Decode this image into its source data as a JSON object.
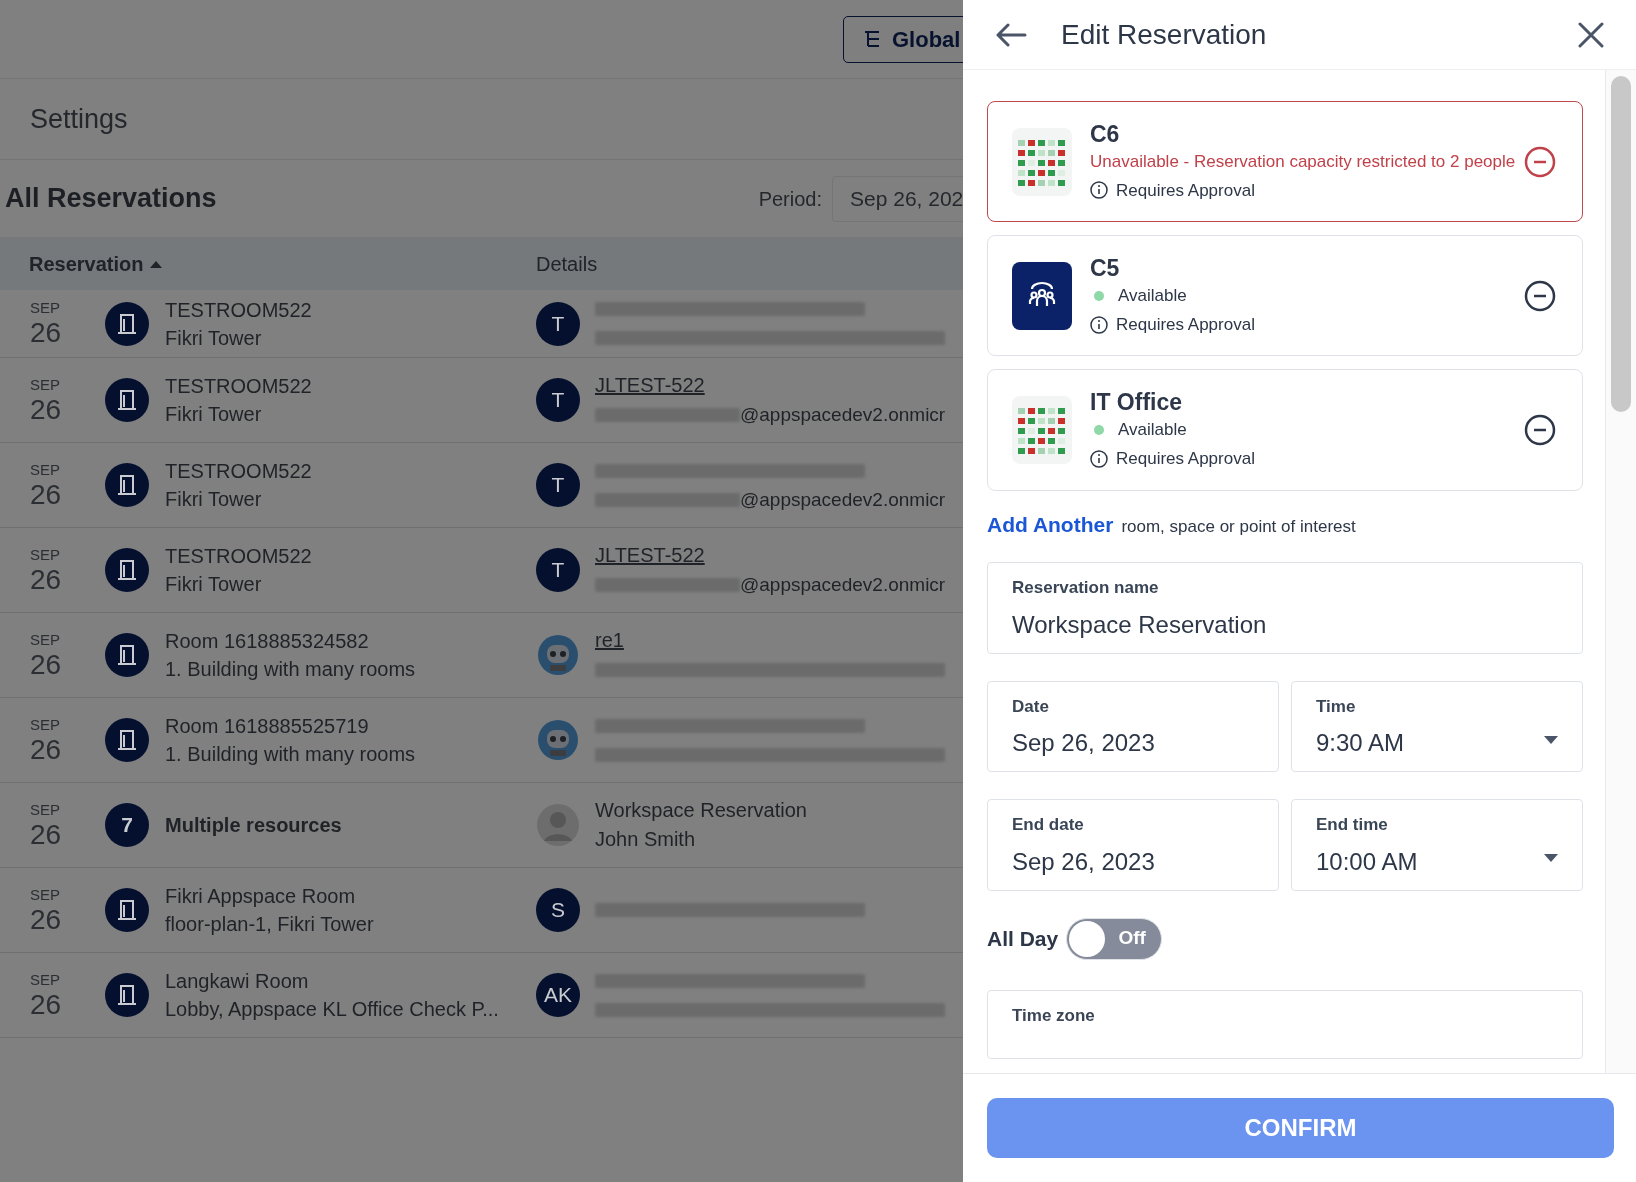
{
  "header": {
    "global_button": "Global"
  },
  "page_title": "Settings",
  "section": {
    "title": "All Reservations",
    "period_label": "Period:",
    "period_value": "Sep 26, 202"
  },
  "table": {
    "columns": [
      {
        "label": "Reservation",
        "sorted": true
      },
      {
        "label": "Details",
        "sorted": false
      }
    ],
    "rows": [
      {
        "month": "SEP",
        "day": "26",
        "resource": {
          "kind": "door"
        },
        "title": "TESTROOM522",
        "subtitle": "Fikri Tower",
        "avatar": {
          "kind": "initial",
          "text": "T"
        },
        "details": [
          {
            "kind": "redacted"
          },
          {
            "kind": "redacted"
          }
        ]
      },
      {
        "month": "SEP",
        "day": "26",
        "resource": {
          "kind": "door"
        },
        "title": "TESTROOM522",
        "subtitle": "Fikri Tower",
        "avatar": {
          "kind": "initial",
          "text": "T"
        },
        "details": [
          {
            "kind": "link",
            "text": "JLTEST-522"
          },
          {
            "kind": "masked",
            "text": "@appspacedev2.onmicr"
          }
        ]
      },
      {
        "month": "SEP",
        "day": "26",
        "resource": {
          "kind": "door"
        },
        "title": "TESTROOM522",
        "subtitle": "Fikri Tower",
        "avatar": {
          "kind": "initial",
          "text": "T"
        },
        "details": [
          {
            "kind": "redacted"
          },
          {
            "kind": "masked",
            "text": "@appspacedev2.onmicr"
          }
        ]
      },
      {
        "month": "SEP",
        "day": "26",
        "resource": {
          "kind": "door"
        },
        "title": "TESTROOM522",
        "subtitle": "Fikri Tower",
        "avatar": {
          "kind": "initial",
          "text": "T"
        },
        "details": [
          {
            "kind": "link",
            "text": "JLTEST-522"
          },
          {
            "kind": "masked",
            "text": "@appspacedev2.onmicr"
          }
        ]
      },
      {
        "month": "SEP",
        "day": "26",
        "resource": {
          "kind": "door"
        },
        "title": "Room 1618885324582",
        "subtitle": "1. Building with many rooms",
        "avatar": {
          "kind": "robot"
        },
        "details": [
          {
            "kind": "link",
            "text": "re1"
          },
          {
            "kind": "redacted"
          }
        ]
      },
      {
        "month": "SEP",
        "day": "26",
        "resource": {
          "kind": "door"
        },
        "title": "Room 1618885525719",
        "subtitle": "1. Building with many rooms",
        "avatar": {
          "kind": "robot"
        },
        "details": [
          {
            "kind": "redacted"
          },
          {
            "kind": "redacted"
          }
        ]
      },
      {
        "month": "SEP",
        "day": "26",
        "resource": {
          "kind": "count",
          "text": "7"
        },
        "title": "Multiple resources",
        "avatar": {
          "kind": "photo"
        },
        "details": [
          {
            "kind": "text",
            "text": "Workspace Reservation"
          },
          {
            "kind": "text",
            "text": "John Smith"
          }
        ]
      },
      {
        "month": "SEP",
        "day": "26",
        "resource": {
          "kind": "door"
        },
        "title": "Fikri Appspace Room",
        "subtitle": "floor-plan-1, Fikri Tower",
        "avatar": {
          "kind": "initial",
          "text": "S"
        },
        "details": [
          {
            "kind": "redacted"
          }
        ]
      },
      {
        "month": "SEP",
        "day": "26",
        "resource": {
          "kind": "door"
        },
        "title": "Langkawi Room",
        "subtitle": "Lobby, Appspace KL Office Check P...",
        "avatar": {
          "kind": "initial",
          "text": "AK"
        },
        "details": [
          {
            "kind": "redacted"
          },
          {
            "kind": "redacted"
          }
        ]
      }
    ]
  },
  "panel": {
    "title": "Edit Reservation",
    "resources": [
      {
        "name": "C6",
        "kind": "floorplan",
        "available": false,
        "status_text": "Unavailable - Reservation capacity restricted to 2 people",
        "note": "Requires Approval"
      },
      {
        "name": "C5",
        "kind": "people",
        "available": true,
        "status_text": "Available",
        "note": "Requires Approval"
      },
      {
        "name": "IT Office",
        "kind": "floorplan",
        "available": true,
        "status_text": "Available",
        "note": "Requires Approval"
      }
    ],
    "add_another": {
      "link": "Add Another",
      "text": "room, space or point of interest"
    },
    "field_rows": [
      [
        {
          "label": "Reservation name",
          "value": "Workspace Reservation",
          "kind": "text"
        }
      ],
      [
        {
          "label": "Date",
          "value": "Sep 26, 2023",
          "kind": "text"
        },
        {
          "label": "Time",
          "value": "9:30 AM",
          "kind": "select"
        }
      ],
      [
        {
          "label": "End date",
          "value": "Sep 26, 2023",
          "kind": "text"
        },
        {
          "label": "End time",
          "value": "10:00 AM",
          "kind": "select"
        }
      ]
    ],
    "all_day": {
      "label": "All Day",
      "on": false,
      "state_text": "Off"
    },
    "time_zone": {
      "label": "Time zone"
    },
    "confirm": "CONFIRM"
  }
}
